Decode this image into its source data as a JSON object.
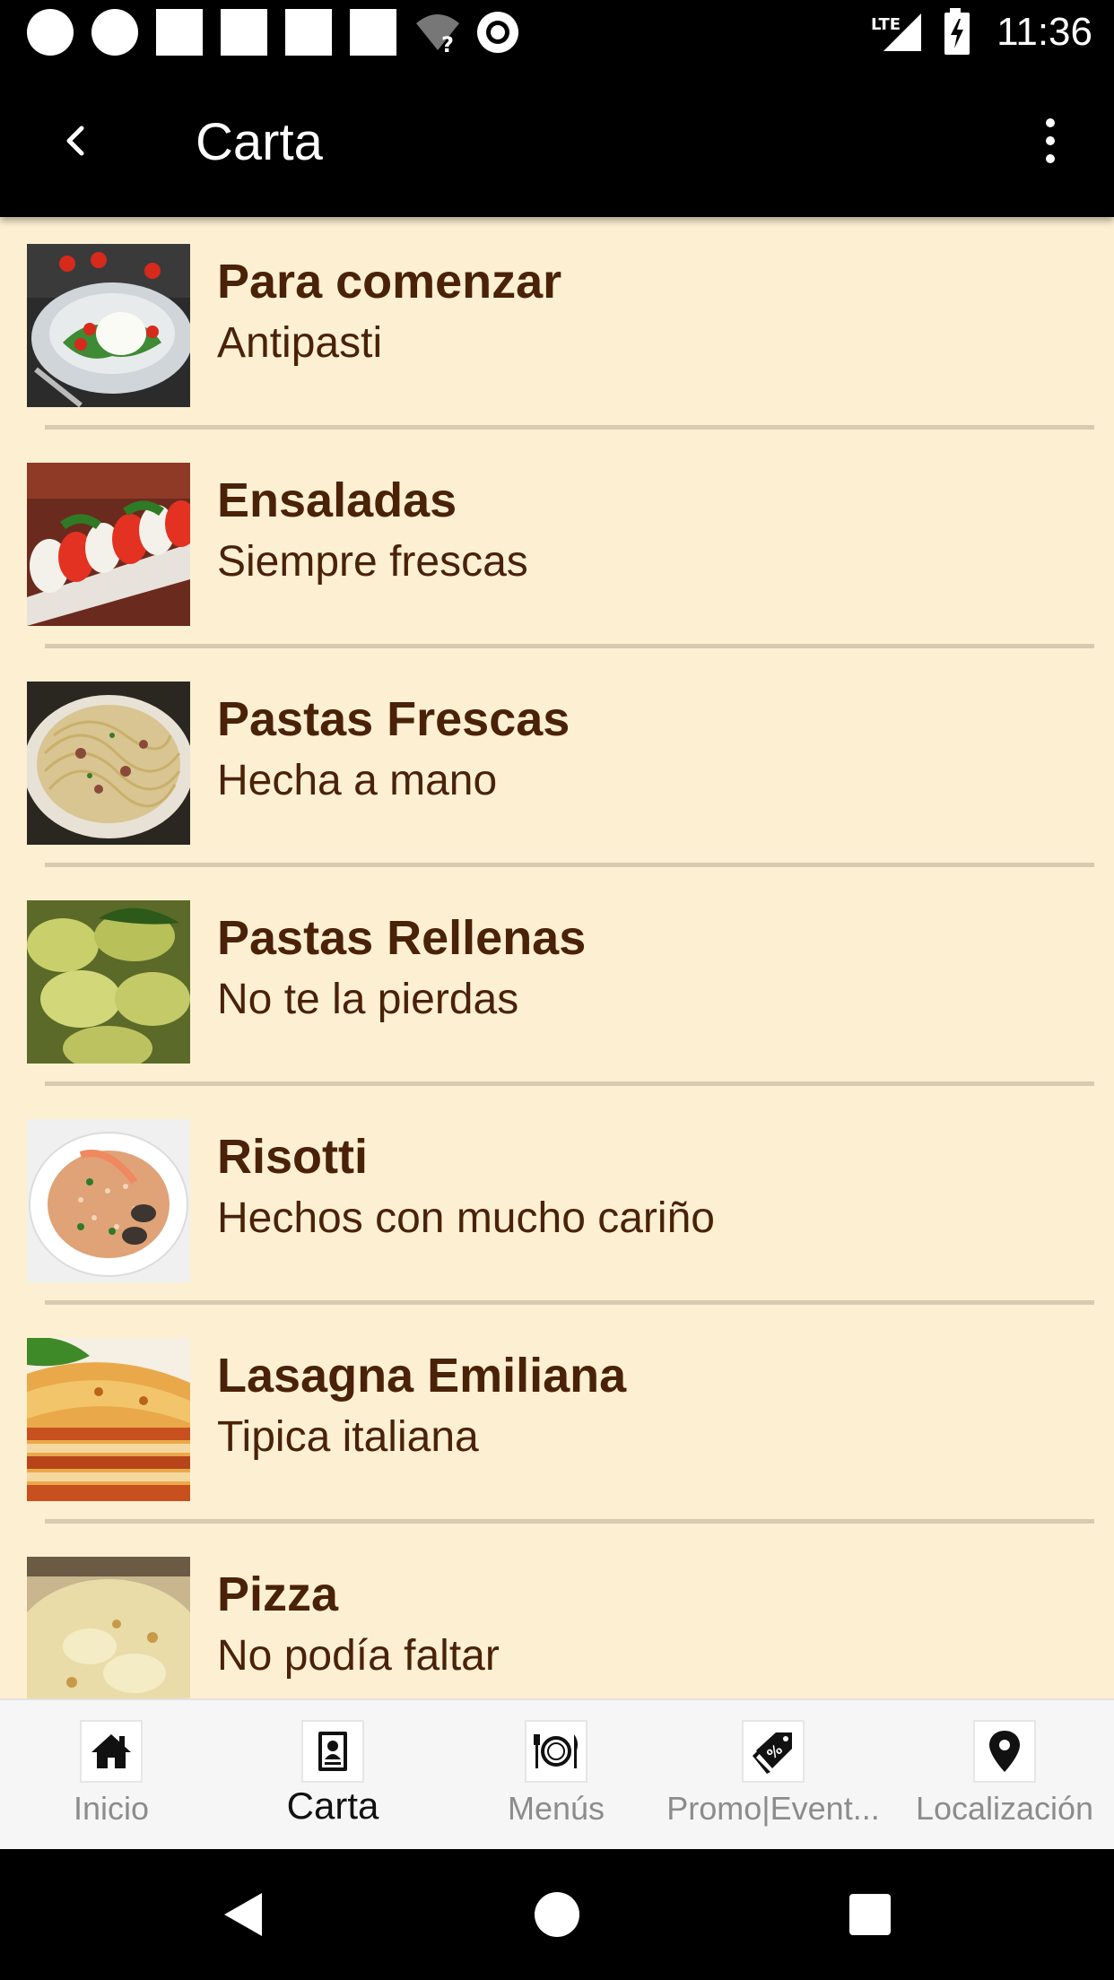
{
  "status_bar": {
    "network_label": "LTE",
    "time": "11:36"
  },
  "app_bar": {
    "title": "Carta",
    "back_icon": "chevron-left-icon",
    "more_icon": "more-vert-icon"
  },
  "menu": {
    "items": [
      {
        "title": "Para comenzar",
        "subtitle": "Antipasti",
        "image": "burrata-salad-photo"
      },
      {
        "title": "Ensaladas",
        "subtitle": "Siempre frescas",
        "image": "caprese-salad-photo"
      },
      {
        "title": "Pastas Frescas",
        "subtitle": "Hecha a mano",
        "image": "spaghetti-photo"
      },
      {
        "title": "Pastas Rellenas",
        "subtitle": "No te la pierdas",
        "image": "tortellini-photo"
      },
      {
        "title": "Risotti",
        "subtitle": "Hechos con mucho cariño",
        "image": "seafood-risotto-photo"
      },
      {
        "title": "Lasagna Emiliana",
        "subtitle": "Tipica italiana",
        "image": "lasagna-photo"
      },
      {
        "title": "Pizza",
        "subtitle": "No podía faltar",
        "image": "pizza-photo"
      }
    ]
  },
  "tab_bar": {
    "tabs": [
      {
        "label": "Inicio",
        "icon": "home-icon",
        "active": false
      },
      {
        "label": "Carta",
        "icon": "menu-card-icon",
        "active": true
      },
      {
        "label": "Menús",
        "icon": "plate-cutlery-icon",
        "active": false
      },
      {
        "label": "Promo|Event...",
        "icon": "discount-tag-icon",
        "active": false
      },
      {
        "label": "Localización",
        "icon": "location-pin-icon",
        "active": false
      }
    ]
  },
  "nav_bar": {
    "back_icon": "nav-back-icon",
    "home_icon": "nav-home-icon",
    "recents_icon": "nav-recents-icon"
  },
  "colors": {
    "background": "#fdf0d2",
    "text_brown": "#4a2208",
    "bar_black": "#000000"
  }
}
